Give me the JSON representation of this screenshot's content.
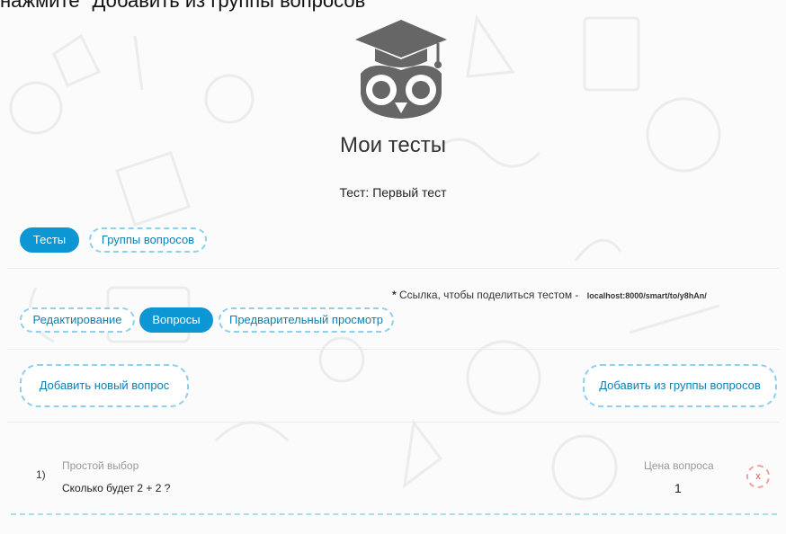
{
  "caption": "нажмите \"Добавить из группы вопросов\"",
  "header": {
    "title": "Мои тесты",
    "test_name": "Тест: Первый тест"
  },
  "main_tabs": [
    {
      "label": "Тесты",
      "active": true
    },
    {
      "label": "Группы вопросов",
      "active": false
    }
  ],
  "share": {
    "star": "*",
    "text": "Ссылка, чтобы поделиться тестом -",
    "link": "localhost:8000/smart/to/y8hAn/"
  },
  "sub_tabs": [
    {
      "label": "Редактирование",
      "active": false
    },
    {
      "label": "Вопросы",
      "active": true
    },
    {
      "label": "Предварительный просмотр",
      "active": false
    }
  ],
  "actions": {
    "add_new": "Добавить новый вопрос",
    "add_from_group": "Добавить из группы вопросов"
  },
  "questions": [
    {
      "number": "1)",
      "type": "Простой выбор",
      "text": "Сколько будет 2 + 2 ?",
      "price_label": "Цена вопроса",
      "price": "1",
      "delete_label": "x"
    }
  ],
  "colors": {
    "accent": "#0d96d4",
    "dashed_border": "#8fd0ec",
    "delete": "#d9534f",
    "logo": "#666666"
  },
  "icons": {
    "logo": "owl-graduation-cap-icon"
  }
}
